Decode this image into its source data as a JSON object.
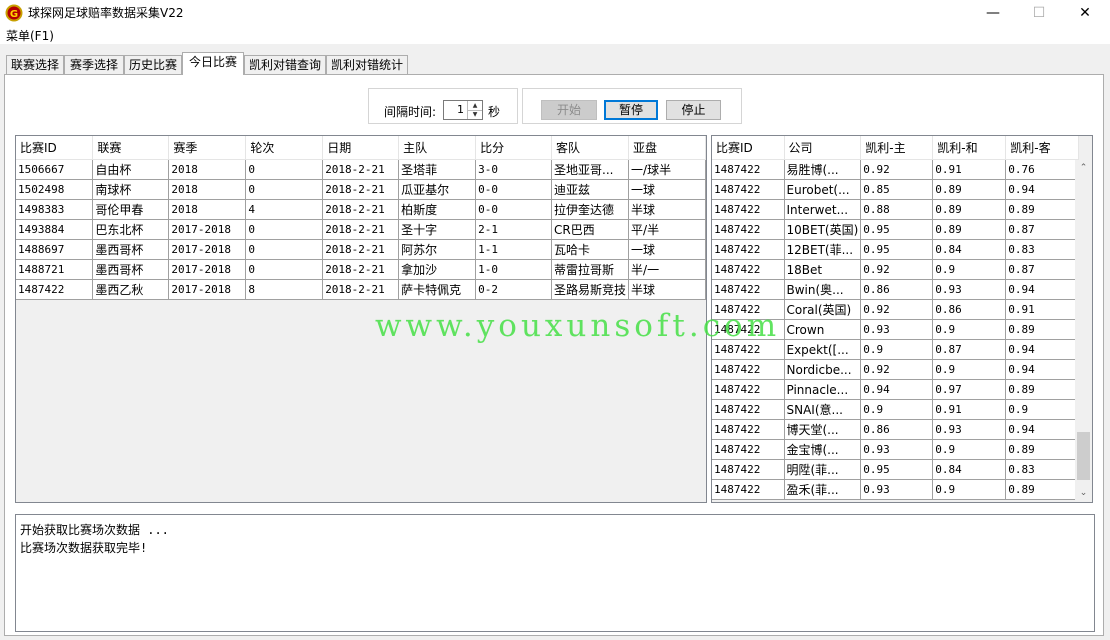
{
  "window": {
    "title": "球探网足球赔率数据采集V22",
    "minimize": "—",
    "maximize": "☐",
    "close": "✕"
  },
  "menu": {
    "main": "菜单(F1)"
  },
  "tabs": [
    {
      "label": "联赛选择"
    },
    {
      "label": "赛季选择"
    },
    {
      "label": "历史比赛"
    },
    {
      "label": "今日比赛",
      "active": true
    },
    {
      "label": "凯利对错查询"
    },
    {
      "label": "凯利对错统计"
    }
  ],
  "controls": {
    "interval_label": "间隔时间:",
    "interval_value": "1",
    "interval_unit": "秒",
    "start": "开始",
    "pause": "暂停",
    "stop": "停止"
  },
  "matches": {
    "columns": [
      "比赛ID",
      "联赛",
      "赛季",
      "轮次",
      "日期",
      "主队",
      "比分",
      "客队",
      "亚盘"
    ],
    "rows": [
      [
        "1506667",
        "自由杯",
        "2018",
        "0",
        "2018-2-21",
        "圣塔菲",
        "3-0",
        "圣地亚哥...",
        "一/球半"
      ],
      [
        "1502498",
        "南球杯",
        "2018",
        "0",
        "2018-2-21",
        "瓜亚基尔",
        "0-0",
        "迪亚兹",
        "一球"
      ],
      [
        "1498383",
        "哥伦甲春",
        "2018",
        "4",
        "2018-2-21",
        "柏斯度",
        "0-0",
        "拉伊奎达德",
        "半球"
      ],
      [
        "1493884",
        "巴东北杯",
        "2017-2018",
        "0",
        "2018-2-21",
        "圣十字",
        "2-1",
        "CR巴西",
        "平/半"
      ],
      [
        "1488697",
        "墨西哥杯",
        "2017-2018",
        "0",
        "2018-2-21",
        "阿苏尔",
        "1-1",
        "瓦哈卡",
        "一球"
      ],
      [
        "1488721",
        "墨西哥杯",
        "2017-2018",
        "0",
        "2018-2-21",
        "拿加沙",
        "1-0",
        "蒂雷拉哥斯",
        "半/一"
      ],
      [
        "1487422",
        "墨西乙秋",
        "2017-2018",
        "8",
        "2018-2-21",
        "萨卡特佩克",
        "0-2",
        "圣路易斯竞技",
        "半球"
      ]
    ]
  },
  "kelly": {
    "columns": [
      "比赛ID",
      "公司",
      "凯利-主",
      "凯利-和",
      "凯利-客"
    ],
    "rows": [
      [
        "1487422",
        "易胜博(...",
        "0.92",
        "0.91",
        "0.76"
      ],
      [
        "1487422",
        "Eurobet(...",
        "0.85",
        "0.89",
        "0.94"
      ],
      [
        "1487422",
        "Interwet...",
        "0.88",
        "0.89",
        "0.89"
      ],
      [
        "1487422",
        "10BET(英国)",
        "0.95",
        "0.89",
        "0.87"
      ],
      [
        "1487422",
        "12BET(菲...",
        "0.95",
        "0.84",
        "0.83"
      ],
      [
        "1487422",
        "18Bet",
        "0.92",
        "0.9",
        "0.87"
      ],
      [
        "1487422",
        "Bwin(奥...",
        "0.86",
        "0.93",
        "0.94"
      ],
      [
        "1487422",
        "Coral(英国)",
        "0.92",
        "0.86",
        "0.91"
      ],
      [
        "1487422",
        "Crown",
        "0.93",
        "0.9",
        "0.89"
      ],
      [
        "1487422",
        "Expekt([...",
        "0.9",
        "0.87",
        "0.94"
      ],
      [
        "1487422",
        "Nordicbe...",
        "0.92",
        "0.9",
        "0.94"
      ],
      [
        "1487422",
        "Pinnacle...",
        "0.94",
        "0.97",
        "0.89"
      ],
      [
        "1487422",
        "SNAI(意...",
        "0.9",
        "0.91",
        "0.9"
      ],
      [
        "1487422",
        "博天堂(...",
        "0.86",
        "0.93",
        "0.94"
      ],
      [
        "1487422",
        "金宝博(...",
        "0.93",
        "0.9",
        "0.89"
      ],
      [
        "1487422",
        "明陞(菲...",
        "0.95",
        "0.84",
        "0.83"
      ],
      [
        "1487422",
        "盈禾(菲...",
        "0.93",
        "0.9",
        "0.89"
      ]
    ]
  },
  "log": [
    "开始获取比赛场次数据 ...",
    "比赛场次数据获取完毕!"
  ],
  "watermark": "www.youxunsoft.com",
  "colors": {
    "watermark": "#46e046",
    "focus": "#0078d7"
  }
}
